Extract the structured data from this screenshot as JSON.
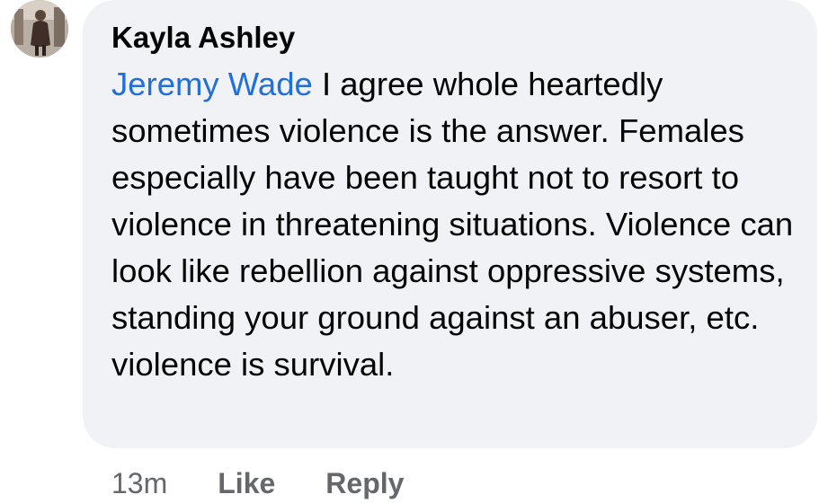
{
  "comment": {
    "author": "Kayla Ashley",
    "mention": "Jeremy Wade",
    "text": " I agree whole heartedly sometimes violence is the answer. Females especially have been taught not to resort to violence in threatening situations. Violence can look like rebellion against oppressive systems, standing your ground against an abuser, etc. violence is survival."
  },
  "actions": {
    "timestamp": "13m",
    "like_label": "Like",
    "reply_label": "Reply"
  },
  "colors": {
    "bubble": "#f0f2f5",
    "mention": "#216fdb",
    "meta": "#65676b",
    "text": "#050505"
  },
  "avatar": {
    "icon": "profile-photo"
  }
}
